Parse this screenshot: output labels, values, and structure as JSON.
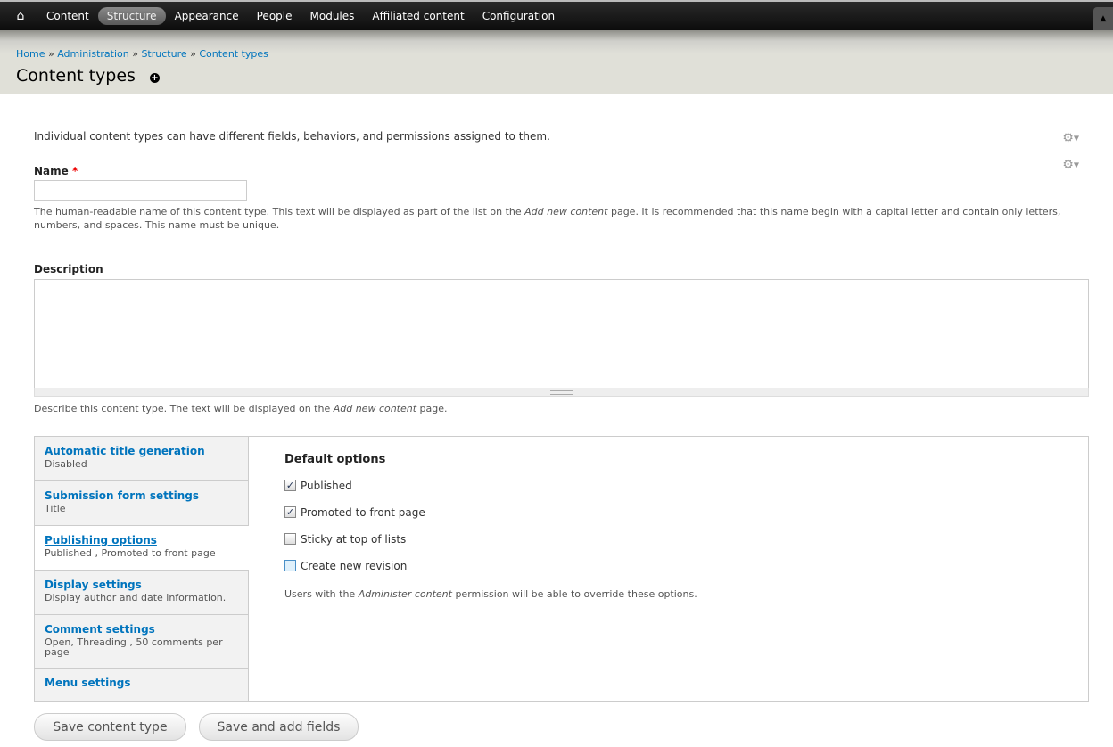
{
  "toolbar": {
    "items": [
      "Content",
      "Structure",
      "Appearance",
      "People",
      "Modules",
      "Affiliated content",
      "Configuration"
    ],
    "active": "Structure"
  },
  "breadcrumb": [
    "Home",
    "Administration",
    "Structure",
    "Content types"
  ],
  "page_title": "Content types",
  "intro": "Individual content types can have different fields, behaviors, and permissions assigned to them.",
  "name": {
    "label": "Name",
    "required_mark": "*",
    "value": "",
    "description_pre": "The human-readable name of this content type. This text will be displayed as part of the list on the ",
    "description_em": "Add new content",
    "description_post": " page. It is recommended that this name begin with a capital letter and contain only letters, numbers, and spaces. This name must be unique."
  },
  "description": {
    "label": "Description",
    "value": "",
    "help_pre": "Describe this content type. The text will be displayed on the ",
    "help_em": "Add new content",
    "help_post": " page."
  },
  "tabs": [
    {
      "title": "Automatic title generation",
      "summary": "Disabled"
    },
    {
      "title": "Submission form settings",
      "summary": "Title"
    },
    {
      "title": "Publishing options",
      "summary": "Published , Promoted to front page"
    },
    {
      "title": "Display settings",
      "summary": "Display author and date information."
    },
    {
      "title": "Comment settings",
      "summary": "Open, Threading , 50 comments per page"
    },
    {
      "title": "Menu settings",
      "summary": ""
    }
  ],
  "publishing": {
    "heading": "Default options",
    "options": [
      {
        "label": "Published",
        "checked": true
      },
      {
        "label": "Promoted to front page",
        "checked": true
      },
      {
        "label": "Sticky at top of lists",
        "checked": false
      },
      {
        "label": "Create new revision",
        "checked": false
      }
    ],
    "note_pre": "Users with the ",
    "note_em": "Administer content",
    "note_post": " permission will be able to override these options."
  },
  "buttons": {
    "save": "Save content type",
    "save_fields": "Save and add fields"
  }
}
